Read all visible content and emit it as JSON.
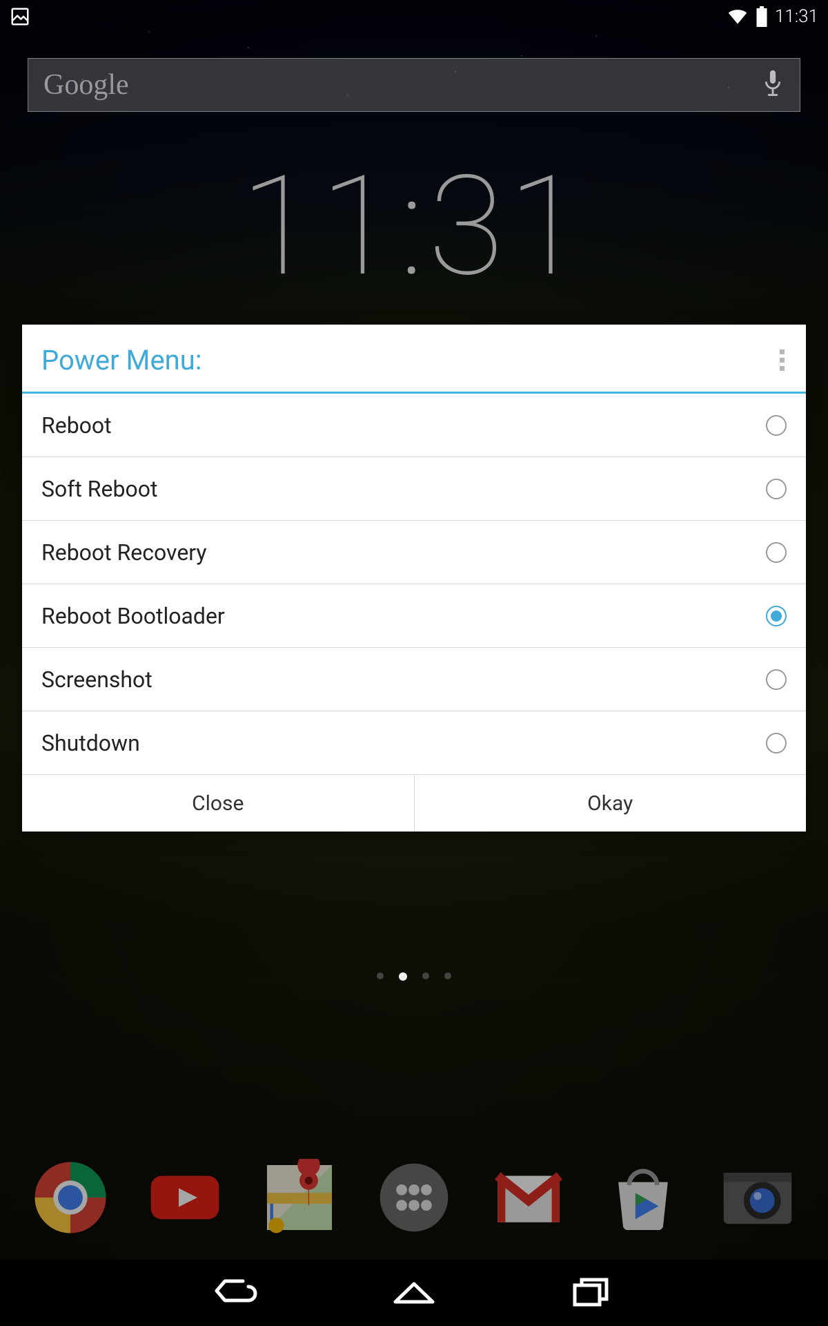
{
  "statusbar": {
    "time": "11:31"
  },
  "search": {
    "logo_text": "Google"
  },
  "clock": {
    "time": "11:31"
  },
  "dialog": {
    "title": "Power Menu:",
    "options": [
      {
        "label": "Reboot",
        "selected": false
      },
      {
        "label": "Soft Reboot",
        "selected": false
      },
      {
        "label": "Reboot Recovery",
        "selected": false
      },
      {
        "label": "Reboot Bootloader",
        "selected": true
      },
      {
        "label": "Screenshot",
        "selected": false
      },
      {
        "label": "Shutdown",
        "selected": false
      }
    ],
    "close_label": "Close",
    "okay_label": "Okay"
  },
  "dock_apps": [
    "Chrome",
    "YouTube",
    "Maps",
    "App Drawer",
    "Gmail",
    "Play Store",
    "Camera"
  ],
  "colors": {
    "accent": "#3fa9d8"
  }
}
